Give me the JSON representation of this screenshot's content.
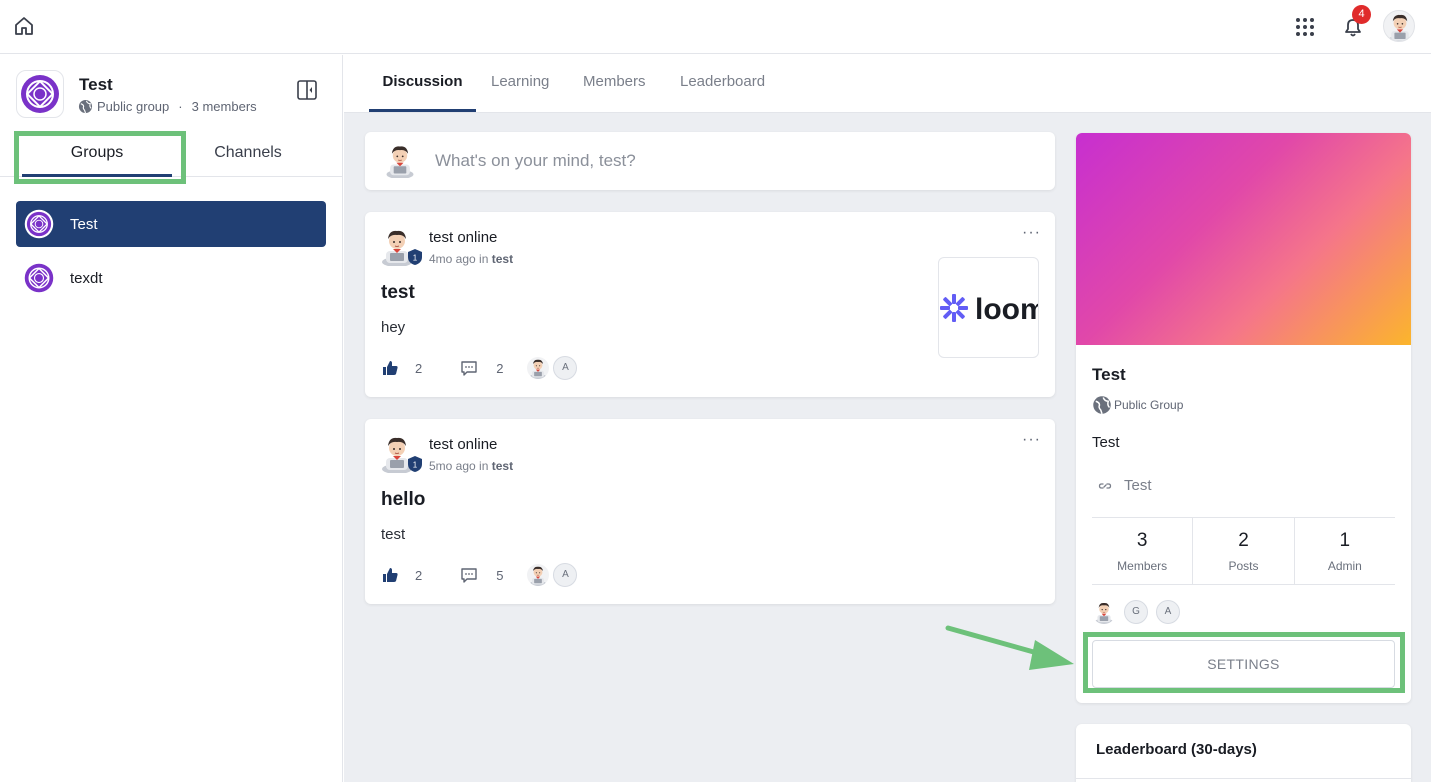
{
  "topbar": {
    "notification_count": "4",
    "icons": [
      "home-icon",
      "apps-grid-icon",
      "bell-icon",
      "user-avatar"
    ]
  },
  "sidebar": {
    "group_name": "Test",
    "group_visibility": "Public group",
    "separator": "·",
    "member_count": "3 members",
    "tabs": [
      {
        "label": "Groups",
        "active": true
      },
      {
        "label": "Channels",
        "active": false
      }
    ],
    "items": [
      {
        "label": "Test",
        "active": true
      },
      {
        "label": "texdt",
        "active": false
      }
    ]
  },
  "main": {
    "tabs": [
      {
        "label": "Discussion",
        "active": true
      },
      {
        "label": "Learning",
        "active": false
      },
      {
        "label": "Members",
        "active": false
      },
      {
        "label": "Leaderboard",
        "active": false
      }
    ],
    "composer_placeholder": "What's on your mind, test?",
    "posts": [
      {
        "author": "test online",
        "badge": "1",
        "time": "4mo ago",
        "in": "in",
        "channel": "test",
        "title": "test",
        "body": "hey",
        "likes": "2",
        "comments": "2",
        "reactor_letter": "A",
        "attachment": "loom"
      },
      {
        "author": "test online",
        "badge": "1",
        "time": "5mo ago",
        "in": "in",
        "channel": "test",
        "title": "hello",
        "body": "test",
        "likes": "2",
        "comments": "5",
        "reactor_letter": "A"
      }
    ]
  },
  "group_card": {
    "name": "Test",
    "type": "Public Group",
    "description": "Test",
    "link": "Test",
    "stats": [
      {
        "value": "3",
        "label": "Members"
      },
      {
        "value": "2",
        "label": "Posts"
      },
      {
        "value": "1",
        "label": "Admin"
      }
    ],
    "member_letters": [
      "G",
      "A"
    ],
    "settings_label": "SETTINGS",
    "banner_colors": [
      "#c72fd0",
      "#fbb52c"
    ]
  },
  "leaderboard": {
    "title": "Leaderboard (30-days)"
  },
  "colors": {
    "accent": "#213f73",
    "highlight": "#6dc17a",
    "badge_red": "#e02b2b",
    "group_logo": "#7a32c8"
  }
}
